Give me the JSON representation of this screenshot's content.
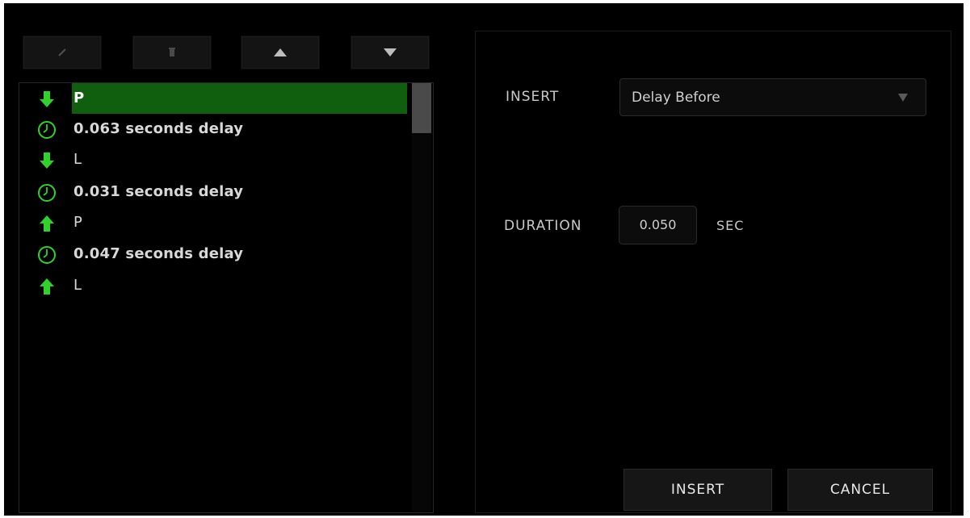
{
  "toolbar": {
    "buttons": [
      {
        "icon": "pencil-icon"
      },
      {
        "icon": "trash-icon"
      },
      {
        "icon": "move-up-arrow-icon"
      },
      {
        "icon": "move-down-arrow-icon"
      }
    ]
  },
  "macro_list": {
    "rows": [
      {
        "icon": "key-down-arrow-icon",
        "label": "P",
        "selected": true
      },
      {
        "icon": "clock-icon",
        "label": "0.063 seconds delay"
      },
      {
        "icon": "key-down-arrow-icon",
        "label": "L"
      },
      {
        "icon": "clock-icon",
        "label": "0.031 seconds delay"
      },
      {
        "icon": "key-up-arrow-icon",
        "label": "P"
      },
      {
        "icon": "clock-icon",
        "label": "0.047 seconds delay"
      },
      {
        "icon": "key-up-arrow-icon",
        "label": "L"
      }
    ]
  },
  "insert_field": {
    "label": "INSERT",
    "selected_value": "Delay Before"
  },
  "duration_field": {
    "label": "DURATION",
    "value": "0.050",
    "unit": "SEC"
  },
  "actions": {
    "insert_label": "INSERT",
    "cancel_label": "CANCEL"
  },
  "colors": {
    "accent_green": "#2fd12a",
    "selected_row_bg": "#0f5f0e",
    "background": "#000000"
  }
}
